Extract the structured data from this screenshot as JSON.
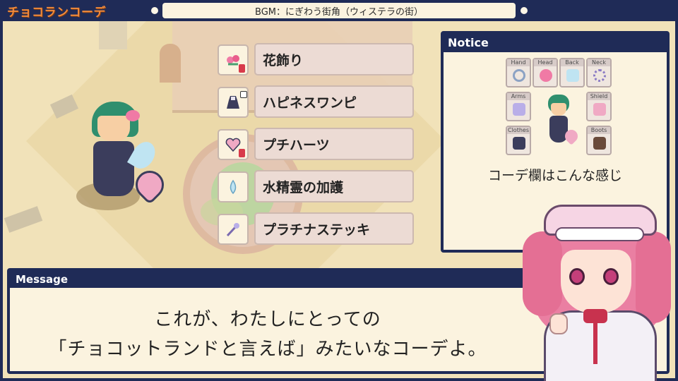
{
  "header": {
    "logo_text": "チョコランコーデ",
    "bgm_text": "BGM：にぎわう街角（ウィステラの街）"
  },
  "equipment": [
    {
      "name": "花飾り",
      "icon": "flower-accessory-icon",
      "badge": "red"
    },
    {
      "name": "ハピネスワンピ",
      "icon": "dress-icon",
      "badge": "D"
    },
    {
      "name": "プチハーツ",
      "icon": "heart-shield-icon",
      "badge": "red"
    },
    {
      "name": "水精霊の加護",
      "icon": "water-spirit-icon",
      "badge": "none"
    },
    {
      "name": "プラチナステッキ",
      "icon": "platinum-staff-icon",
      "badge": "none"
    }
  ],
  "notice": {
    "title": "Notice",
    "slots": [
      {
        "label": "Hand",
        "icon": "ring-icon"
      },
      {
        "label": "Head",
        "icon": "flower-accessory-icon"
      },
      {
        "label": "Back",
        "icon": "water-spirit-icon"
      },
      {
        "label": "Neck",
        "icon": "necklace-icon"
      },
      {
        "label": "Arms",
        "icon": "platinum-staff-icon"
      },
      {
        "label": "Shield",
        "icon": "heart-shield-icon"
      },
      {
        "label": "Clothes",
        "icon": "dress-icon"
      },
      {
        "label": "Boots",
        "icon": "boots-icon"
      }
    ],
    "caption": "コーデ欄はこんな感じ"
  },
  "message": {
    "title": "Message",
    "line1": "これが、わたしにとっての",
    "line2": "「チョコットランドと言えば」みたいなコーデよ。"
  },
  "colors": {
    "frame": "#1f2b57",
    "logo": "#f08a3c",
    "panel_bg": "#fbf3df",
    "label_bg": "#ecdbd4"
  }
}
